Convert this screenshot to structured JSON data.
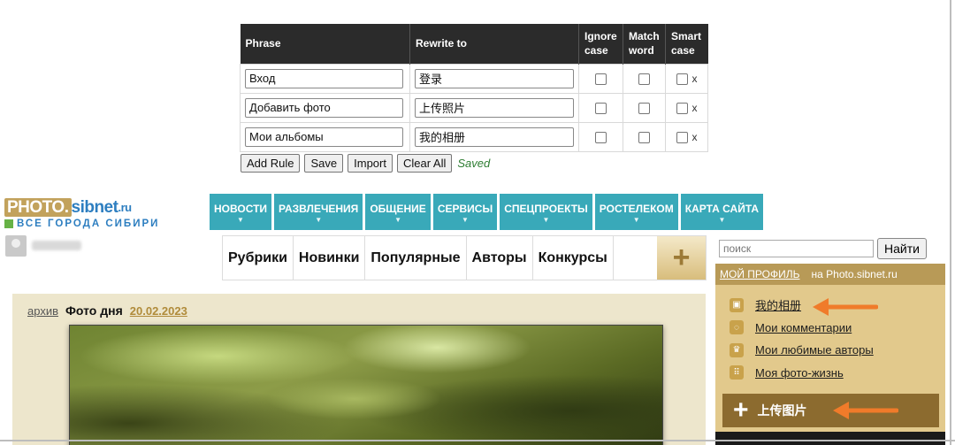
{
  "rules": {
    "headers": {
      "phrase": "Phrase",
      "rewrite": "Rewrite to",
      "ignore_case": [
        "Ignore",
        "case"
      ],
      "match_word": [
        "Match",
        "word"
      ],
      "smart_case": [
        "Smart",
        "case"
      ]
    },
    "rows": [
      {
        "phrase": "Вход",
        "rewrite": "登录",
        "delete": "x"
      },
      {
        "phrase": "Добавить фото",
        "rewrite": "上传照片",
        "delete": "x"
      },
      {
        "phrase": "Мои альбомы",
        "rewrite": "我的相册",
        "delete": "x"
      }
    ],
    "buttons": {
      "add": "Add Rule",
      "save": "Save",
      "import": "Import",
      "clear": "Clear All"
    },
    "status": "Saved"
  },
  "site": {
    "logo": {
      "photo": "PHOTO.",
      "sibnet": "sibnet",
      "ru": ".ru",
      "tagline": "ВСЕ ГОРОДА СИБИРИ"
    },
    "topnav": [
      "НОВОСТИ",
      "РАЗВЛЕЧЕНИЯ",
      "ОБЩЕНИЕ",
      "СЕРВИСЫ",
      "СПЕЦПРОЕКТЫ",
      "РОСТЕЛЕКОМ",
      "КАРТА САЙТА"
    ],
    "subnav": [
      "Рубрики",
      "Новинки",
      "Популярные",
      "Авторы",
      "Конкурсы"
    ],
    "subnav_plus": "+",
    "search": {
      "placeholder": "поиск",
      "button": "Найти"
    },
    "sidebar": {
      "title": "МОЙ ПРОФИЛЬ",
      "subtitle": "на Photo.sibnet.ru",
      "items": [
        {
          "label": "我的相册",
          "icon": "album-icon"
        },
        {
          "label": "Мои комментарии",
          "icon": "comment-icon"
        },
        {
          "label": "Мои любимые авторы",
          "icon": "crown-icon"
        },
        {
          "label": "Моя фото-жизнь",
          "icon": "grid-icon"
        }
      ],
      "upload": "上传图片"
    },
    "photo_of_day": {
      "archive": "архив",
      "title": "Фото дня",
      "date": "20.02.2023"
    }
  },
  "colors": {
    "nav_teal": "#39a9b9",
    "sidebar_tan": "#e2c98c",
    "sidebar_head": "#b89a57",
    "upload_brown": "#8c6b2f",
    "arrow_orange": "#f07b2a",
    "saved_green": "#2e7d32"
  }
}
